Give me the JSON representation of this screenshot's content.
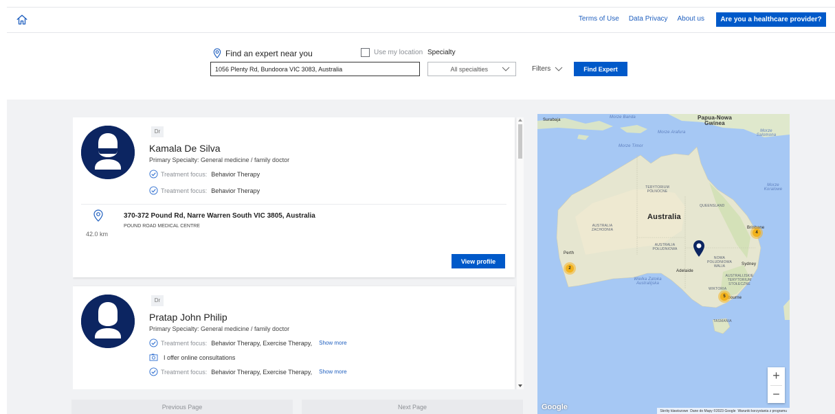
{
  "header": {
    "links": [
      "Terms of Use",
      "Data Privacy",
      "About us"
    ],
    "provider_button": "Are you a healthcare provider?"
  },
  "search": {
    "location_label": "Find an expert near you",
    "use_location_label": "Use my location",
    "use_location_checked": false,
    "address_value": "1056 Plenty Rd, Bundoora VIC 3083, Australia",
    "specialty_label": "Specialty",
    "specialty_selected": "All specialties",
    "filters_label": "Filters",
    "find_button": "Find Expert"
  },
  "results": [
    {
      "title": "Dr",
      "name": "Kamala De Silva",
      "primary_specialty": "Primary Specialty: General medicine / family doctor",
      "focus_rows": [
        {
          "label": "Treatment focus:",
          "value": "Behavior Therapy"
        },
        {
          "label": "Treatment focus:",
          "value": "Behavior Therapy"
        }
      ],
      "address": "370-372 Pound Rd, Narre Warren South VIC 3805, Australia",
      "centre": "POUND ROAD MEDICAL CENTRE",
      "distance": "42.0 km",
      "view_button": "View profile"
    },
    {
      "title": "Dr",
      "name": "Pratap John Philip",
      "primary_specialty": "Primary Specialty: General medicine / family doctor",
      "focus_rows": [
        {
          "label": "Treatment focus:",
          "value": "Behavior Therapy,  Exercise Therapy,",
          "more": "Show more"
        },
        {
          "label": "Treatment focus:",
          "value": "Behavior Therapy,  Exercise Therapy,",
          "more": "Show more"
        }
      ],
      "online_text": "I offer online consultations"
    }
  ],
  "pagination": {
    "previous": "Previous Page",
    "next": "Next Page"
  },
  "map": {
    "labels": {
      "surabaja": "Surabaja",
      "morze_banda": "Morze Banda",
      "papua": "Papua-Nowa Gwinea",
      "morze_arafura": "Morze Arafura",
      "morze_salomona": "Morze Salomona",
      "morze_timor": "Morze Timor",
      "terytorium": "TERYTORIUM PÓŁNOCNE",
      "queensland": "QUEENSLAND",
      "morze_koralowe": "Morze Koralowe",
      "australia": "Australia",
      "australia_zach": "AUSTRALIA ZACHODNIA",
      "brisbane": "Brisbane",
      "australia_pol": "AUSTRALIA POŁUDNIOWA",
      "perth": "Perth",
      "nowa_walia": "NOWA POŁUDNIOWA WALIA",
      "sydney": "Sydney",
      "adelaide": "Adelaide",
      "act": "AUSTRALIJSKIE TERYTORIUM STOŁECZNE",
      "wielka_zatoka": "Wielka Zatoka Australijska",
      "wiktoria": "WIKTORIA",
      "melbourne": "Melbourne",
      "tasmania": "TASMANIA"
    },
    "clusters": {
      "perth": "2",
      "brisbane": "4",
      "melbourne": "5"
    },
    "zoom_in": "+",
    "zoom_out": "−",
    "logo": "Google",
    "footer": [
      "Skróty klawiszowe",
      "Dane do Mapy ©2023 Google",
      "Warunki korzystania z programu"
    ]
  },
  "colors": {
    "primary": "#0059c9",
    "avatar": "#0c2561",
    "link": "#1f5fbf"
  }
}
